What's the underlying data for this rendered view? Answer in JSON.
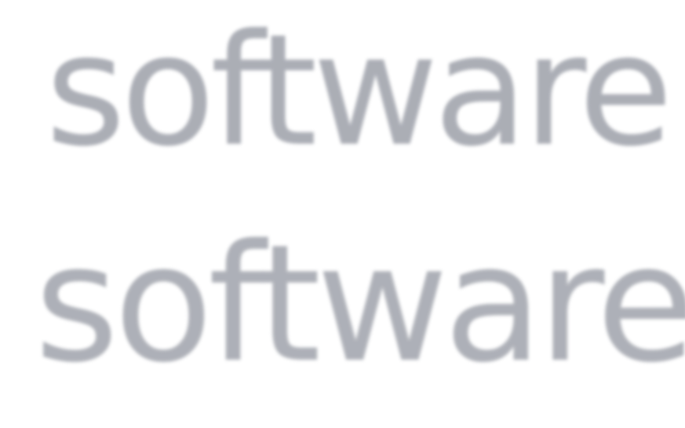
{
  "words": {
    "top": "software",
    "bottom": "software"
  },
  "colors": {
    "background": "#ffffff",
    "text": "#a7aab2"
  }
}
